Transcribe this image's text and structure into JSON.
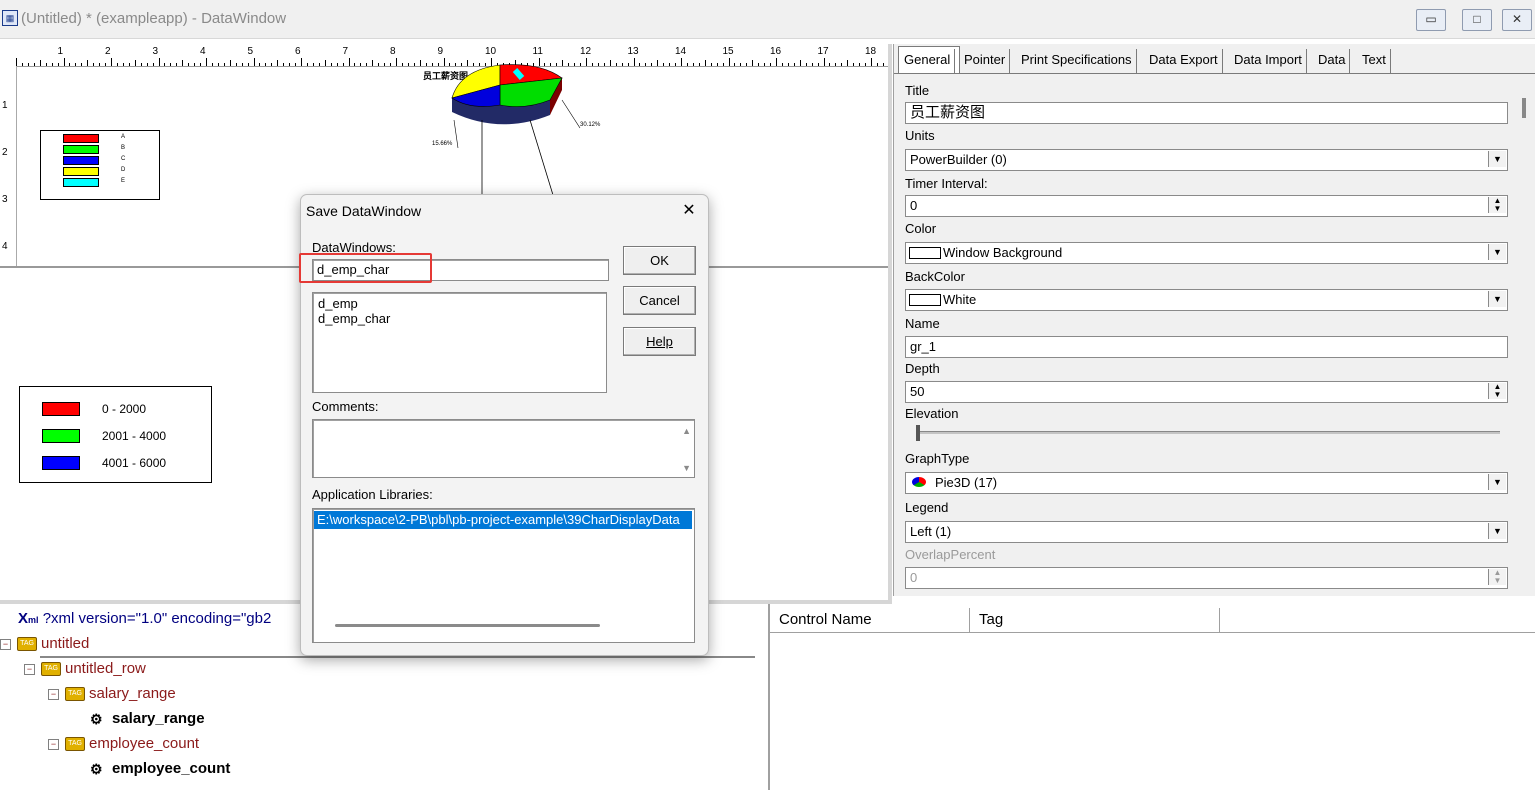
{
  "window": {
    "title": "(Untitled) * (exampleapp) - DataWindow",
    "app_icon": "datawindow-icon",
    "buttons": [
      "▭",
      "□",
      "✕"
    ]
  },
  "design": {
    "ruler_numbers": [
      "1",
      "2",
      "3",
      "4",
      "5",
      "6",
      "7",
      "8",
      "9",
      "10",
      "11",
      "12",
      "13",
      "14",
      "15",
      "16",
      "17",
      "18"
    ],
    "vruler_numbers": [
      "1",
      "2",
      "3",
      "4"
    ],
    "graph": {
      "title": "员工薪资图",
      "labels": [
        "30.12%",
        "15.66%"
      ],
      "legend_small": [
        {
          "label": "A",
          "color": "#ff0000"
        },
        {
          "label": "B",
          "color": "#00ff00"
        },
        {
          "label": "C",
          "color": "#0000ff"
        },
        {
          "label": "D",
          "color": "#ffff00"
        },
        {
          "label": "E",
          "color": "#00ffff"
        }
      ]
    },
    "legend_main": [
      {
        "label": "0 - 2000",
        "color": "#ff0000"
      },
      {
        "label": "2001 - 4000",
        "color": "#00ff00"
      },
      {
        "label": "4001 - 6000",
        "color": "#0000ff"
      }
    ]
  },
  "dialog": {
    "title": "Save DataWindow",
    "datawindows_label": "DataWindows:",
    "name_value": "d_emp_char",
    "list": [
      "d_emp",
      "d_emp_char"
    ],
    "comments_label": "Comments:",
    "app_libraries_label": "Application Libraries:",
    "library": "E:\\workspace\\2-PB\\pbl\\pb-project-example\\39CharDisplayData",
    "ok": "OK",
    "cancel": "Cancel",
    "help": "Help"
  },
  "properties": {
    "tabs": [
      "General",
      "Pointer",
      "Print Specifications",
      "Data Export",
      "Data Import",
      "Data",
      "Text"
    ],
    "fields": {
      "title_label": "Title",
      "title_value": "员工薪资图",
      "units_label": "Units",
      "units_value": "PowerBuilder (0)",
      "timer_label": "Timer Interval:",
      "timer_value": "0",
      "color_label": "Color",
      "color_value": "Window Background",
      "backcolor_label": "BackColor",
      "backcolor_value": "White",
      "name_label": "Name",
      "name_value": "gr_1",
      "depth_label": "Depth",
      "depth_value": "50",
      "elevation_label": "Elevation",
      "graphtype_label": "GraphType",
      "graphtype_value": "Pie3D (17)",
      "legend_label": "Legend",
      "legend_value": "Left (1)",
      "overlap_label": "OverlapPercent",
      "overlap_value": "0"
    }
  },
  "tree": {
    "xml_decl": "?xml version=\"1.0\" encoding=\"gb2",
    "items": [
      {
        "label": "untitled"
      },
      {
        "label": "untitled_row"
      },
      {
        "label": "salary_range"
      },
      {
        "label": "salary_range"
      },
      {
        "label": "employee_count"
      },
      {
        "label": "employee_count"
      }
    ]
  },
  "grid": {
    "columns": [
      "Control Name",
      "Tag"
    ]
  }
}
